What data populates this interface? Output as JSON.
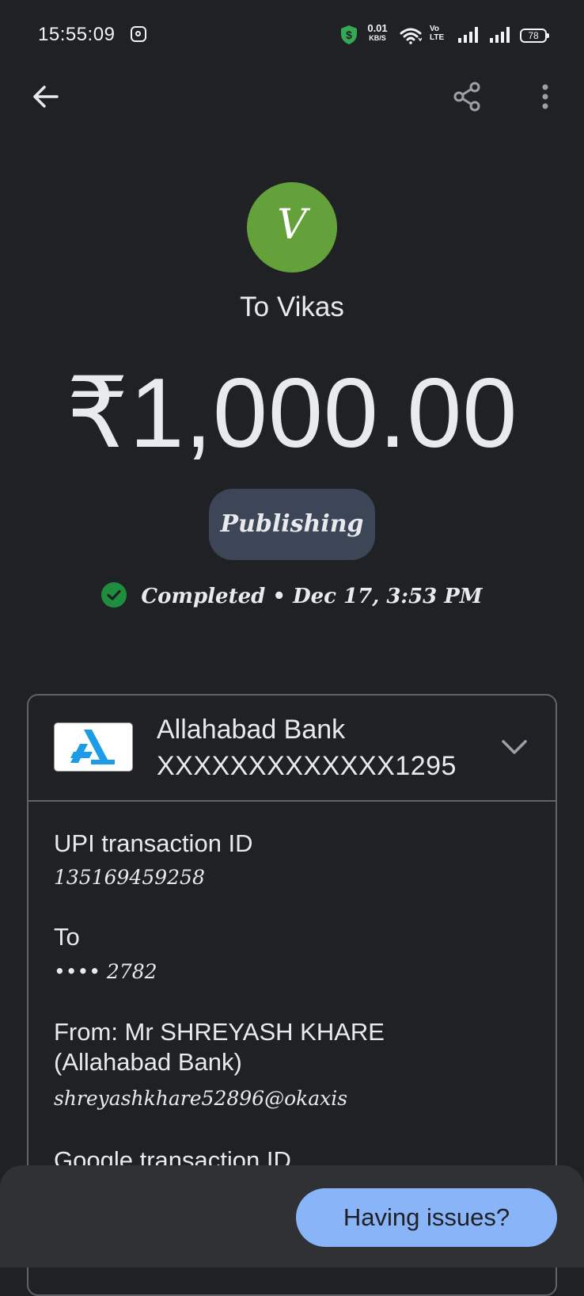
{
  "status_bar": {
    "time": "15:55:09",
    "net_speed_value": "0.01",
    "net_speed_unit": "KB/S",
    "volte_top": "Vo",
    "volte_bottom": "LTE",
    "battery": "78"
  },
  "toolbar": {
    "back_icon": "arrow-left",
    "share_icon": "share",
    "more_icon": "more-vertical"
  },
  "payment": {
    "avatar_letter": "V",
    "avatar_color": "#65a13b",
    "recipient": "To Vikas",
    "amount": "₹1,000.00",
    "note": "Publishing",
    "status": "Completed",
    "separator": "•",
    "datetime": "Dec 17, 3:53 PM",
    "status_color": "#1e8e3e"
  },
  "bank": {
    "name": "Allahabad Bank",
    "account": "XXXXXXXXXXXXX1295",
    "logo_color": "#1c9be6"
  },
  "details": [
    {
      "label": "UPI transaction ID",
      "value": "135169459258"
    },
    {
      "label": "To",
      "value": "•••• 2782"
    },
    {
      "label": "From: Mr SHREYASH  KHARE (Allahabad Bank)",
      "value": "shreyashkhare52896@okaxis"
    },
    {
      "label": "Google transaction ID",
      "value": ""
    }
  ],
  "bottom": {
    "issues_button": "Having issues?",
    "accent": "#8ab4f8"
  }
}
